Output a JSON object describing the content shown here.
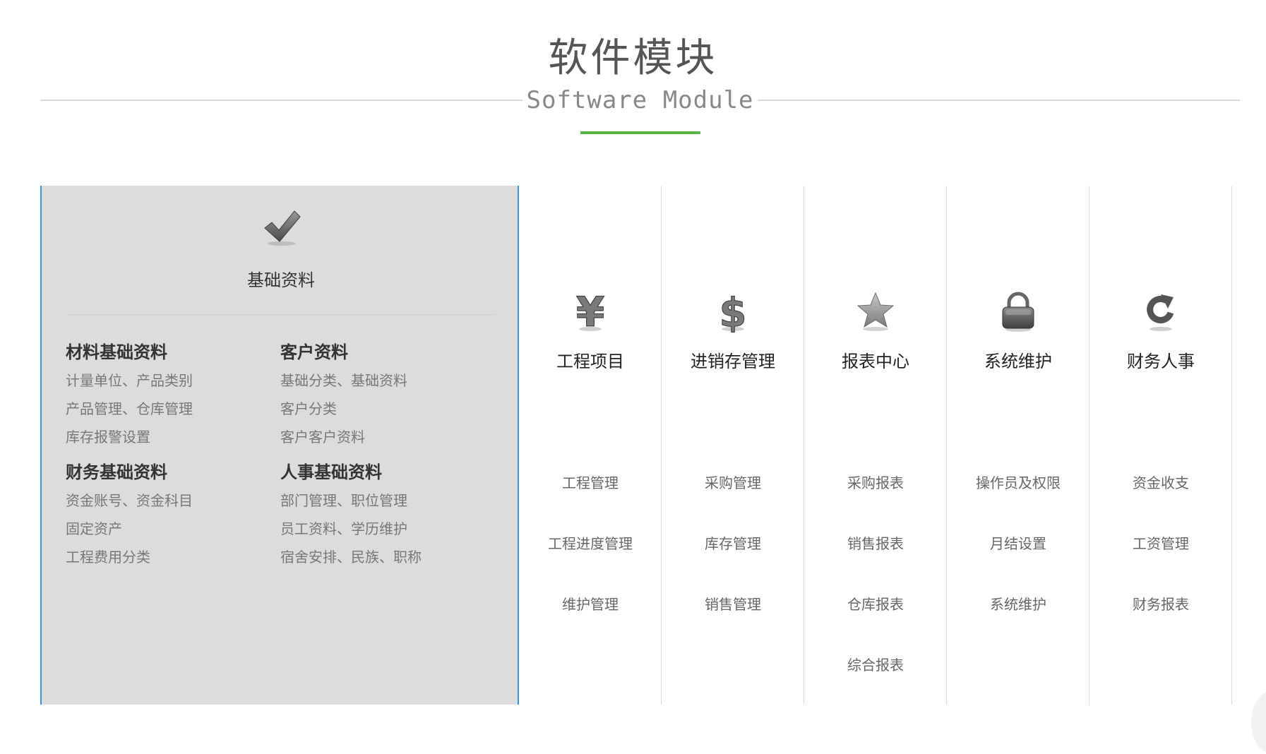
{
  "header": {
    "title": "软件模块",
    "subtitle": "Software Module",
    "accent_color": "#5ab348"
  },
  "featured": {
    "icon": "checkmark-icon",
    "title": "基础资料",
    "border_color": "#3b95d8",
    "groups": [
      {
        "title": "材料基础资料",
        "items": [
          "计量单位、产品类别",
          "产品管理、仓库管理",
          "库存报警设置"
        ]
      },
      {
        "title": "客户资料",
        "items": [
          "基础分类、基础资料",
          "客户分类",
          "客户客户资料"
        ]
      },
      {
        "title": "财务基础资料",
        "items": [
          "资金账号、资金科目",
          "固定资产",
          "工程费用分类"
        ]
      },
      {
        "title": "人事基础资料",
        "items": [
          "部门管理、职位管理",
          "员工资料、学历维护",
          "宿舍安排、民族、职称"
        ]
      }
    ]
  },
  "columns": [
    {
      "icon": "yen-icon",
      "title": "工程项目",
      "items": [
        "工程管理",
        "工程进度管理",
        "维护管理"
      ]
    },
    {
      "icon": "dollar-icon",
      "title": "进销存管理",
      "items": [
        "采购管理",
        "库存管理",
        "销售管理"
      ]
    },
    {
      "icon": "star-icon",
      "title": "报表中心",
      "items": [
        "采购报表",
        "销售报表",
        "仓库报表",
        "综合报表"
      ]
    },
    {
      "icon": "lock-icon",
      "title": "系统维护",
      "items": [
        "操作员及权限",
        "月结设置",
        "系统维护"
      ]
    },
    {
      "icon": "refresh-icon",
      "title": "财务人事",
      "items": [
        "资金收支",
        "工资管理",
        "财务报表"
      ]
    }
  ]
}
